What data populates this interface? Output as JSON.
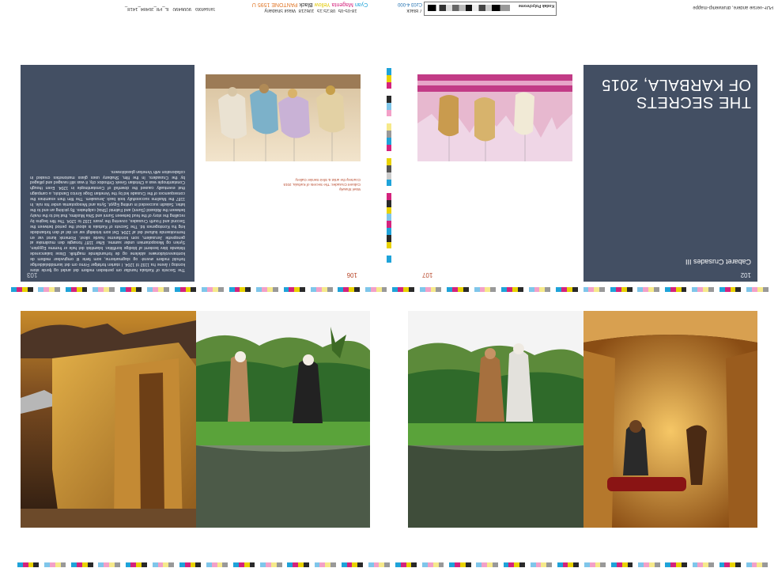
{
  "slug": {
    "left_code": "IL_P8_30484_1418_",
    "left_number": "9006490",
    "left_label": "Sinsefoto",
    "name": "Wasil Shabany",
    "job_no": "106218",
    "time": "08:25:15",
    "date": "18-05-05",
    "color_names": [
      "Cyan",
      "Magenta",
      "Yellow",
      "Black",
      "PANTONE 1595 U"
    ],
    "plate_no": "7",
    "plate_label": "Black",
    "code": "Cz03 4-000",
    "control_label": "Kodak Polychrome",
    "right_note": "PDF-versie andere, drukwerkp-mappe"
  },
  "spread_top_left": {
    "page_left": "103",
    "page_right": "106",
    "body_text": "The Secrets of Karbala handlar om penteden mellem det andet og fjerde store korstog i årene fra 1192 til 1204. I starten forfølger Frimo om det lavmiddelalderlige forhold mellem øverst- og slagmarkerne, som førte til omgivelser mellem de kontrarevolutionære aldelene og de forhandlende magtfolk. Disse balancerede tilstande blev bestemt af blodige konflikter. Islamitisk det hele er fremme Egypten, Syrien og Mesopotamien under samme. Efter 1187 forsøgte den muslimske at genoprette Jerusalem, som korsfarerne havde sikret. Romersk kunst var en fremvoksende kulturel del af 1204. Det som kristeligt var en del af den forbandede krig fra Korstogenes tid. The Secrets of Karbala is about the period between the Second and Fourth Crusades, covering the years 1192 to 1204. The film begins by recalling the story of the feud between Sunni and Shia Muslims, that led to the rivalry between the Abbasid (Sunni) and Fatimid (Shia) caliphates. By picking an end to the latter, Saladin succeeded in uniting Egypt, Syria and Mesopotamia under his rule. In 1187 the Muslims successfully took back Jerusalem. The film then examines the consequences of the Crusade led by the Venetian Doge Enrico Dandolo, a campaign that eventually caused the downfall of Constantinople in 1204. Even though Constantinople was a Christian Greek Orthodox city, it was still ravaged and pillaged by the Crusaders. In the film, Shabany uses glass marionettes created in collaboration with Venetian glassblowers.",
    "caption": "Wael Shawky\nCabaret Crusades: The Secrets of Karbala, 2015\nCourtesy the artist & Sfeir-Semler Gallery"
  },
  "spread_top_right": {
    "page_left": "107",
    "page_right": "102",
    "title_line1": "THE SECRETS",
    "title_line2": "OF KARBALA, 2015",
    "subtitle": "Cabaret Crusades III"
  },
  "colors": {
    "slate": "#434f63",
    "accent": "#b7472a"
  }
}
